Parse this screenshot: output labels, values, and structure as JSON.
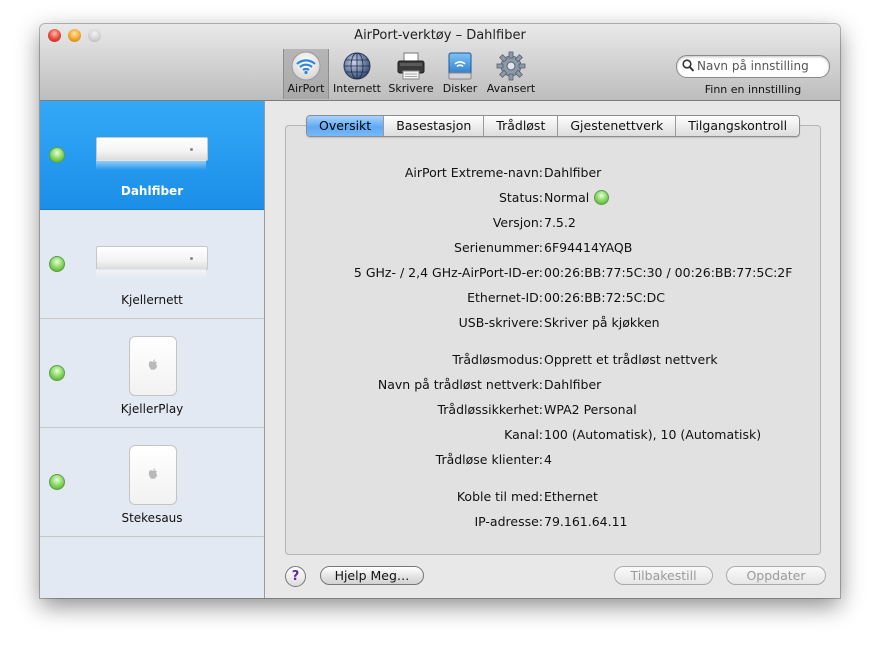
{
  "window": {
    "title": "AirPort-verktøy – Dahlfiber"
  },
  "toolbar": {
    "items": [
      {
        "label": "AirPort",
        "icon": "airport-wifi-icon",
        "selected": true
      },
      {
        "label": "Internett",
        "icon": "globe-icon"
      },
      {
        "label": "Skrivere",
        "icon": "printer-icon"
      },
      {
        "label": "Disker",
        "icon": "disk-icon"
      },
      {
        "label": "Avansert",
        "icon": "gear-icon"
      }
    ],
    "search": {
      "placeholder": "Navn på innstilling",
      "caption": "Finn en innstilling"
    }
  },
  "sidebar": {
    "items": [
      {
        "label": "Dahlfiber",
        "status": "green",
        "device": "airport-extreme-icon",
        "selected": true
      },
      {
        "label": "Kjellernett",
        "status": "green",
        "device": "airport-extreme-icon"
      },
      {
        "label": "KjellerPlay",
        "status": "green",
        "device": "airport-express-icon"
      },
      {
        "label": "Stekesaus",
        "status": "green",
        "device": "airport-express-icon"
      }
    ]
  },
  "tabs": [
    {
      "label": "Oversikt",
      "active": true
    },
    {
      "label": "Basestasjon"
    },
    {
      "label": "Trådløst"
    },
    {
      "label": "Gjestenettverk"
    },
    {
      "label": "Tilgangskontroll"
    }
  ],
  "summary": {
    "rows": [
      {
        "label": "AirPort Extreme-navn:",
        "value": "Dahlfiber"
      },
      {
        "label": "Status:",
        "value": "Normal",
        "status_color": "#7fd35a"
      },
      {
        "label": "Versjon:",
        "value": "7.5.2"
      },
      {
        "label": "Serienummer:",
        "value": "6F94414YAQB"
      },
      {
        "label": "5 GHz- / 2,4 GHz-AirPort-ID-er:",
        "value": "00:26:BB:77:5C:30 / 00:26:BB:77:5C:2F"
      },
      {
        "label": "Ethernet-ID:",
        "value": "00:26:BB:72:5C:DC"
      },
      {
        "label": "USB-skrivere:",
        "value": "Skriver på kjøkken"
      },
      {
        "label": "Trådløsmodus:",
        "value": "Opprett et trådløst nettverk"
      },
      {
        "label": "Navn på trådløst nettverk:",
        "value": "Dahlfiber"
      },
      {
        "label": "Trådløssikkerhet:",
        "value": "WPA2 Personal"
      },
      {
        "label": "Kanal:",
        "value": "100 (Automatisk), 10 (Automatisk)"
      },
      {
        "label": "Trådløse klienter:",
        "value": "4"
      },
      {
        "label": "Koble til med:",
        "value": "Ethernet"
      },
      {
        "label": "IP-adresse:",
        "value": "79.161.64.11"
      }
    ]
  },
  "footer": {
    "help": "?",
    "help_me": "Hjelp Meg…",
    "revert": "Tilbakestill",
    "update": "Oppdater"
  },
  "colors": {
    "accent": "#1b8fe8",
    "status_ok": "#7fd35a",
    "help_purple": "#5b2a9e"
  }
}
